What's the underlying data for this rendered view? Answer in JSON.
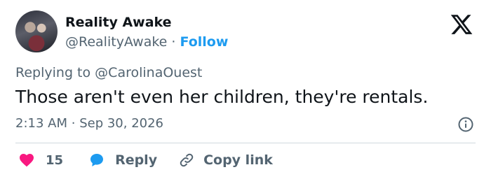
{
  "author": {
    "display_name": "Reality Awake",
    "handle": "@RealityAwake",
    "separator": "·",
    "follow_label": "Follow"
  },
  "reply": {
    "prefix": "Replying to",
    "handle": "@CarolinaOuest"
  },
  "tweet": {
    "text": "Those aren't even her children, they're rentals.",
    "time": "2:13 AM",
    "separator": "·",
    "date": "Sep 30, 2026"
  },
  "actions": {
    "likes_count": "15",
    "reply_label": "Reply",
    "copy_label": "Copy link"
  },
  "colors": {
    "accent": "#1d9bf0",
    "like": "#f91880",
    "text_primary": "#0f1419",
    "text_secondary": "#536471",
    "divider": "#cfd9de"
  },
  "icons": {
    "brand": "x-logo-icon",
    "info": "info-icon",
    "like": "heart-icon",
    "reply": "speech-bubble-icon",
    "copy": "link-icon"
  }
}
